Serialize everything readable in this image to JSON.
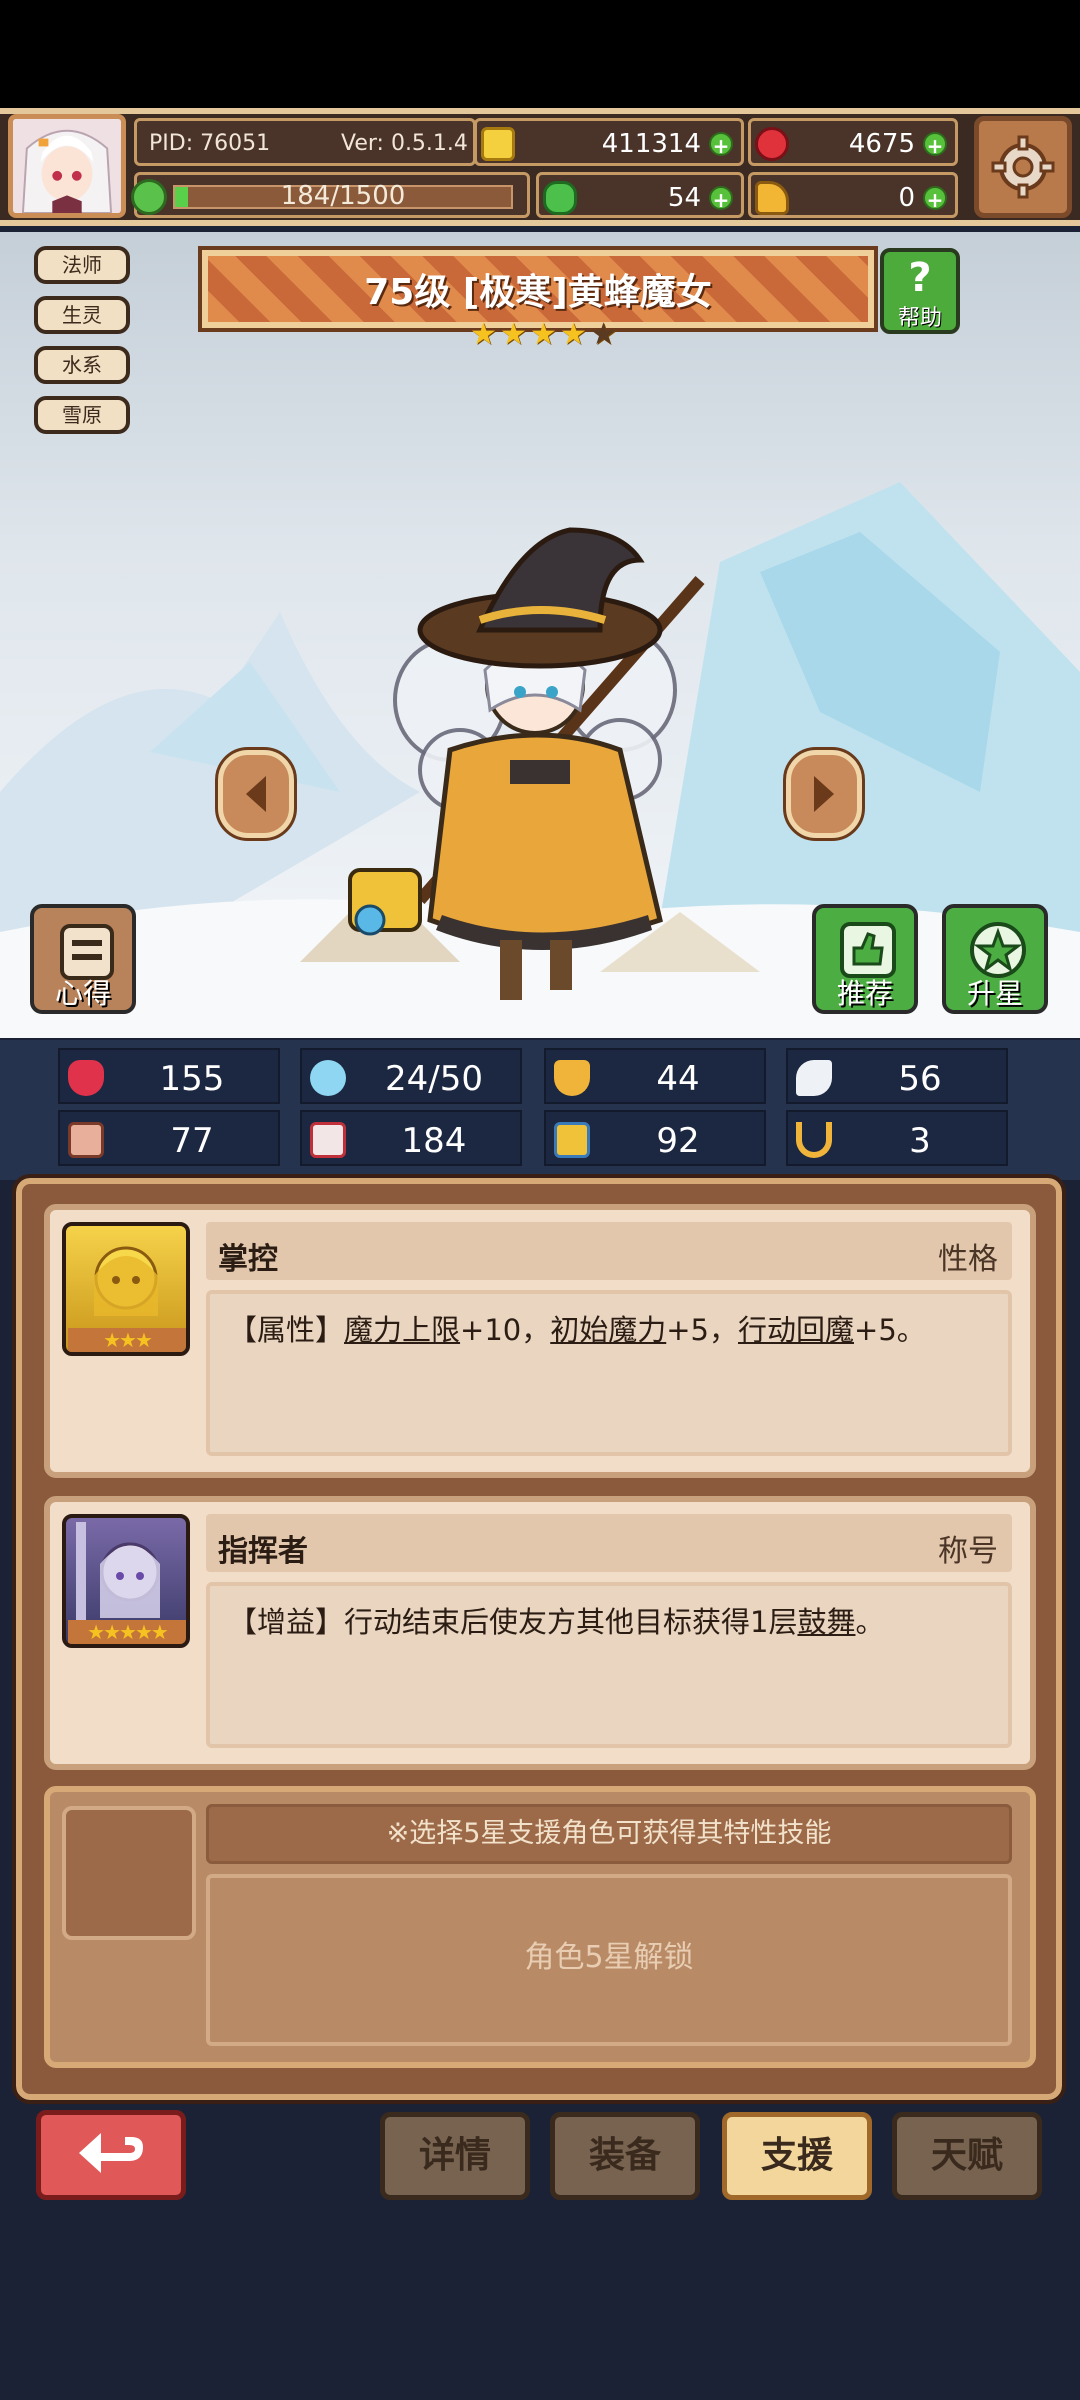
{
  "header": {
    "pid": "PID: 76051",
    "version": "Ver: 0.5.1.4",
    "gold": "411314",
    "gems": "4675",
    "stamina": "184/1500",
    "clover": "54",
    "keys": "0"
  },
  "tags": [
    "法师",
    "生灵",
    "水系",
    "雪原"
  ],
  "character": {
    "title": "75级 [极寒]黄蜂魔女",
    "stars_filled": 4,
    "stars_total": 5,
    "help_label": "帮助",
    "notes_label": "心得",
    "recommend_label": "推荐",
    "star_up_label": "升星"
  },
  "stats": {
    "hp": "155",
    "mana": "24/50",
    "defense": "44",
    "speed": "56",
    "attack": "77",
    "magic": "184",
    "stat7": "92",
    "stat8": "3"
  },
  "cards": [
    {
      "name": "掌控",
      "type": "性格",
      "stars": "★★★",
      "desc_prefix": "【属性】",
      "link1": "魔力上限",
      "mid1": "+10，",
      "link2": "初始魔力",
      "mid2": "+5，",
      "link3": "行动回魔",
      "suffix": "+5。"
    },
    {
      "name": "指挥者",
      "type": "称号",
      "stars": "★★★★★",
      "desc_prefix": "【增益】行动结束后使友方其他目标获得1层",
      "link1": "鼓舞",
      "suffix": "。"
    }
  ],
  "locked": {
    "hint": "※选择5星支援角色可获得其特性技能",
    "unlock": "角色5星解锁"
  },
  "nav": {
    "details": "详情",
    "equip": "装备",
    "support": "支援",
    "talent": "天赋"
  }
}
